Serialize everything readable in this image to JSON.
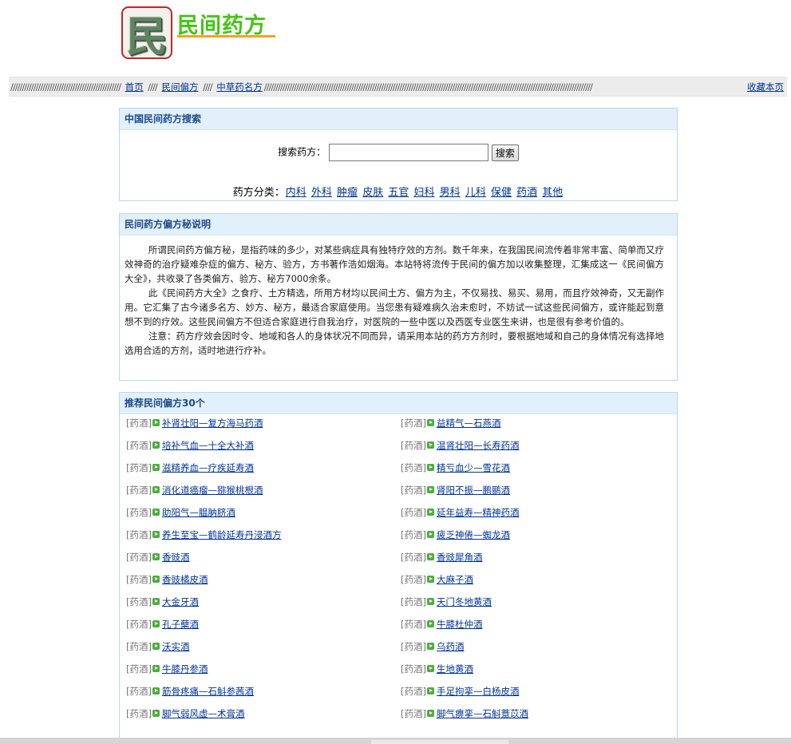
{
  "header": {
    "logo_char": "民",
    "site_title": "民间药方",
    "colors": {
      "title_green": "#44c414",
      "underline_orange": "#f2a12a",
      "logo_border": "#c0282a"
    }
  },
  "nav": {
    "left_slashes": "////////////////////////////////////////////////",
    "sep1": "////",
    "sep2": "////",
    "trail_slashes": "///////////////////////////////////////////////////////////////////////////////////////////////////////////////////////////////////////////////",
    "links": [
      {
        "label": "首页"
      },
      {
        "label": "民间偏方"
      },
      {
        "label": "中草药名方"
      }
    ],
    "bookmark": "收藏本页"
  },
  "search": {
    "heading": "中国民间药方搜索",
    "label": "搜索药方：",
    "input_value": "",
    "button": "搜索",
    "category_label": "药方分类：",
    "categories": [
      "内科",
      "外科",
      "肿瘤",
      "皮肤",
      "五官",
      "妇科",
      "男科",
      "儿科",
      "保健",
      "药酒",
      "其他"
    ]
  },
  "about": {
    "heading": "民间药方偏方秘说明",
    "paragraphs": [
      "所谓民间药方偏方秘，是指药味的多少，对某些病症具有独特疗效的方剂。数千年来，在我国民间流传着非常丰富、简单而又疗效神奇的治疗疑难杂症的偏方、秘方、验方，方书著作浩如烟海。本站特将流传于民间的偏方加以收集整理，汇集成这一《民间偏方大全》，共收录了各类偏方、验方、秘方7000余条。",
      "此《民间药方大全》之食疗、土方精选，所用方材均以民间土方、偏方为主，不仅易找、易买、易用，而且疗效神奇，又无副作用。它汇集了古今诸多名方、妙方、秘方，最适合家庭使用。当您患有疑难病久治未愈时，不妨试一试这些民间偏方，或许能起到意想不到的疗效。这些民间偏方不但适合家庭进行自我治疗，对医院的一些中医以及西医专业医生来讲，也是很有参考价值的。",
      "注意：药方疗效会因时令、地域和各人的身体状况不同而异，请采用本站的药方方剂时，要根据地域和自己的身体情况有选择地选用合适的方剂，适时地进行疗补。"
    ]
  },
  "recommend": {
    "heading": "推荐民间偏方30个",
    "category_tag": "[药酒]",
    "left": [
      "补肾壮阳—复方海马药酒",
      "培补气血—十全大补酒",
      "滋精养血—疗疾延寿酒",
      "消化道癌瘤—猕猴桃根酒",
      "助阳气—腽肭脐酒",
      "养生至宝—鹤龄延寿丹浸酒方",
      "香豉酒",
      "香豉橘皮酒",
      "大金牙酒",
      "孔子蘖酒",
      "沃实酒",
      "牛膝丹参酒",
      "筋骨疼痛—石斛参茜酒",
      "脚气弱风虚—术膏酒"
    ],
    "right": [
      "益精气—石燕酒",
      "温肾壮阳—长寿药酒",
      "精亏血少—雪花酒",
      "肾阳不振—鹏鹂酒",
      "延年益寿—精神药酒",
      "疲乏神倦—蜘龙酒",
      "香豉犀角酒",
      "大麻子酒",
      "天门冬地黄酒",
      "牛膝杜仲酒",
      "乌药酒",
      "生地黄酒",
      "手足拘挛—白杨皮酒",
      "脚气痹挛—石斛薏苡酒"
    ]
  }
}
